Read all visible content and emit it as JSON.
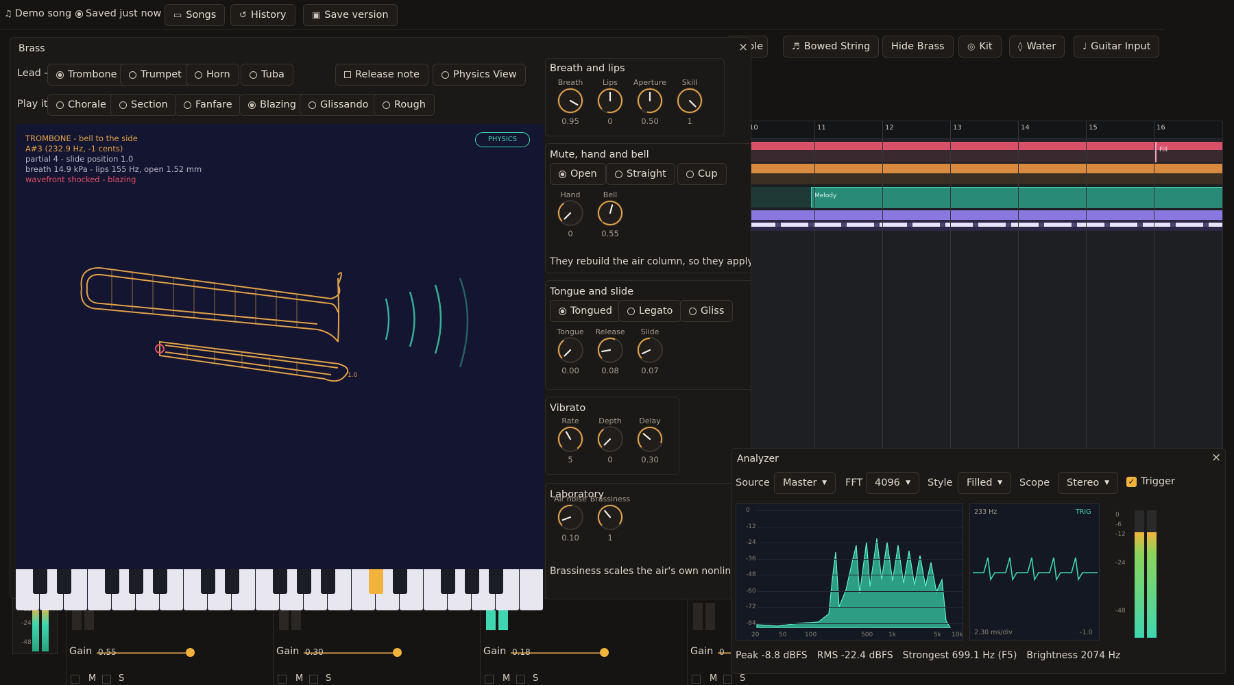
{
  "topbar": {
    "song": "Demo song",
    "saved": "Saved just now",
    "songs": "Songs",
    "history": "History",
    "save_version": "Save version"
  },
  "toolbar2": {
    "partial": "ble",
    "bowed": "Bowed String",
    "hide_brass": "Hide Brass",
    "kit": "Kit",
    "water": "Water",
    "guitar": "Guitar Input"
  },
  "brass": {
    "title": "Brass",
    "lead_label": "Lead -",
    "lead": [
      {
        "label": "Trombone",
        "on": true
      },
      {
        "label": "Trumpet",
        "on": false
      },
      {
        "label": "Horn",
        "on": false
      },
      {
        "label": "Tuba",
        "on": false
      }
    ],
    "release_note": "Release note",
    "physics_view": "Physics View",
    "play_label": "Play it:",
    "play": [
      {
        "label": "Chorale",
        "on": false
      },
      {
        "label": "Section",
        "on": false
      },
      {
        "label": "Fanfare",
        "on": false
      },
      {
        "label": "Blazing",
        "on": true
      },
      {
        "label": "Glissando",
        "on": false
      },
      {
        "label": "Rough",
        "on": false
      }
    ],
    "viz": {
      "line1": "TROMBONE  -  bell to the side",
      "line2": "A#3  (232.9 Hz, -1 cents)",
      "line3": "partial 4  -  slide position 1.0",
      "line4": "breath 14.9 kPa  -  lips 155 Hz, open 1.52 mm",
      "line5": "wavefront shocked - blazing",
      "physics_badge": "PHYSICS",
      "slide_tag": "1.0"
    },
    "breath": {
      "title": "Breath and lips",
      "knobs": [
        {
          "label": "Breath",
          "value": "0.95"
        },
        {
          "label": "Lips",
          "value": "0"
        },
        {
          "label": "Aperture",
          "value": "0.50"
        },
        {
          "label": "Skill",
          "value": "1"
        }
      ]
    },
    "mute": {
      "title": "Mute, hand and bell",
      "options": [
        {
          "label": "Open",
          "on": true
        },
        {
          "label": "Straight",
          "on": false
        },
        {
          "label": "Cup",
          "on": false
        }
      ],
      "knobs": [
        {
          "label": "Hand",
          "value": "0"
        },
        {
          "label": "Bell",
          "value": "0.55"
        }
      ],
      "note": "They rebuild the air column, so they apply f"
    },
    "tongue": {
      "title": "Tongue and slide",
      "options": [
        {
          "label": "Tongued",
          "on": true
        },
        {
          "label": "Legato",
          "on": false
        },
        {
          "label": "Gliss",
          "on": false
        }
      ],
      "knobs": [
        {
          "label": "Tongue",
          "value": "0.00"
        },
        {
          "label": "Release",
          "value": "0.08"
        },
        {
          "label": "Slide",
          "value": "0.07"
        }
      ]
    },
    "vibrato": {
      "title": "Vibrato",
      "knobs": [
        {
          "label": "Rate",
          "value": "5"
        },
        {
          "label": "Depth",
          "value": "0"
        },
        {
          "label": "Delay",
          "value": "0.30"
        }
      ]
    },
    "lab": {
      "title": "Laboratory",
      "knobs": [
        {
          "label": "Air noise",
          "value": "0.10"
        },
        {
          "label": "Brassiness",
          "value": "1"
        }
      ],
      "note": "Brassiness scales the air's own nonlinea"
    }
  },
  "timeline": {
    "bars": [
      "10",
      "11",
      "12",
      "13",
      "14",
      "15",
      "16"
    ],
    "clips": [
      "Fill",
      "Melody"
    ]
  },
  "analyzer": {
    "title": "Analyzer",
    "source_label": "Source",
    "source": "Master",
    "fft_label": "FFT",
    "fft": "4096",
    "style_label": "Style",
    "style": "Filled",
    "scope_label": "Scope",
    "scope": "Stereo",
    "trigger": "Trigger",
    "y_ticks": [
      "0",
      "-12",
      "-24",
      "-36",
      "-48",
      "-60",
      "-72",
      "-84"
    ],
    "x_ticks": [
      "20",
      "50",
      "100",
      "500",
      "1k",
      "5k",
      "10k"
    ],
    "scope_freq": "233 Hz",
    "scope_trig": "TRIG",
    "scope_div": "2.30 ms/div",
    "scope_amp": "-1.0",
    "meter_ticks": [
      "0",
      "-6",
      "-12",
      "-24",
      "-48"
    ],
    "stats": {
      "peak": "Peak -8.8 dBFS",
      "rms": "RMS -22.4 dBFS",
      "strongest": "Strongest 699.1 Hz (F5)",
      "brightness": "Brightness 2074 Hz"
    }
  },
  "mixer": {
    "gain_label": "Gain",
    "channels": [
      {
        "gain": "0.55",
        "level": 0.55
      },
      {
        "gain": "0.30",
        "level": 0.3
      },
      {
        "gain": "0.18",
        "level": 0.18
      },
      {
        "gain": "0",
        "level": 0
      }
    ],
    "mute": "M",
    "solo": "S",
    "meter_ticks": [
      "-12",
      "-24",
      "-48"
    ]
  },
  "colors": {
    "accent": "#f2b33d",
    "teal": "#3fd6b0",
    "red_clip": "#d9506a",
    "orange_clip": "#d98a3f",
    "purple_clip": "#8a78e0"
  }
}
